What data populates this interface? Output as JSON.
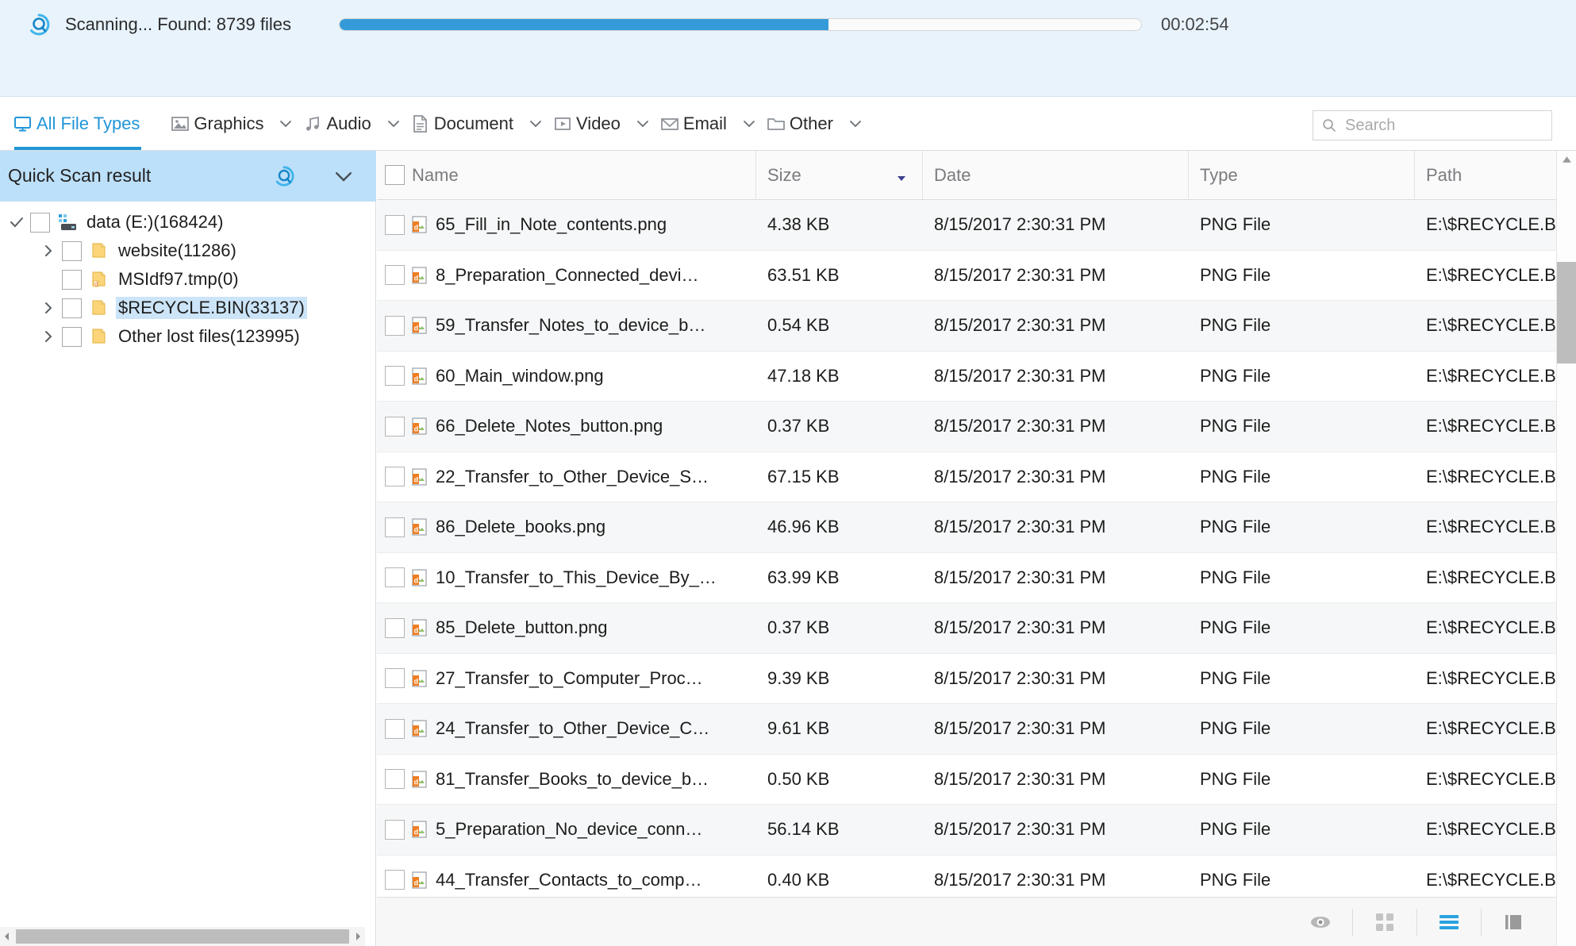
{
  "scan": {
    "status_text": "Scanning... Found: 8739 files",
    "progress_percent": 61,
    "elapsed_time": "00:02:54",
    "scan_icon": "scan-target-icon",
    "accent_color": "#349bd8",
    "bar_background": "#e8f3fc"
  },
  "filters": {
    "tabs": [
      {
        "label": "All File Types",
        "icon": "monitor-icon",
        "active": true,
        "has_caret": false
      },
      {
        "label": "Graphics",
        "icon": "image-icon",
        "active": false,
        "has_caret": true
      },
      {
        "label": "Audio",
        "icon": "music-note-icon",
        "active": false,
        "has_caret": true
      },
      {
        "label": "Document",
        "icon": "document-icon",
        "active": false,
        "has_caret": true
      },
      {
        "label": "Video",
        "icon": "play-frame-icon",
        "active": false,
        "has_caret": true
      },
      {
        "label": "Email",
        "icon": "envelope-icon",
        "active": false,
        "has_caret": true
      },
      {
        "label": "Other",
        "icon": "folder-outline-icon",
        "active": false,
        "has_caret": true
      }
    ],
    "active_color": "#2196d8"
  },
  "search": {
    "placeholder": "Search",
    "value": "",
    "icon": "search-icon"
  },
  "sidebar": {
    "title": "Quick Scan result",
    "header_icon": "scan-target-icon",
    "collapse_icon": "chevron-down-icon",
    "header_background": "#bde0fa",
    "selection_color": "#cce4f7",
    "tree": [
      {
        "label": "data (E:)(168424)",
        "level": 1,
        "icon": "drive-icon",
        "expander": "check-mark",
        "checked": false,
        "selected": false
      },
      {
        "label": "website(11286)",
        "level": 2,
        "icon": "folder-icon",
        "expander": "chevron-right",
        "checked": false,
        "selected": false
      },
      {
        "label": "MSIdf97.tmp(0)",
        "level": 2,
        "icon": "folder-doc-icon",
        "expander": "none",
        "checked": false,
        "selected": false
      },
      {
        "label": "$RECYCLE.BIN(33137)",
        "level": 2,
        "icon": "folder-icon",
        "expander": "chevron-right",
        "checked": false,
        "selected": true
      },
      {
        "label": "Other lost files(123995)",
        "level": 2,
        "icon": "folder-icon",
        "expander": "chevron-right",
        "checked": false,
        "selected": false
      }
    ]
  },
  "table": {
    "columns": [
      {
        "key": "name",
        "label": "Name",
        "has_checkbox": true,
        "sorted": false
      },
      {
        "key": "size",
        "label": "Size",
        "has_checkbox": false,
        "sorted": true,
        "sort_direction": "desc"
      },
      {
        "key": "date",
        "label": "Date",
        "has_checkbox": false,
        "sorted": false
      },
      {
        "key": "type",
        "label": "Type",
        "has_checkbox": false,
        "sorted": false
      },
      {
        "key": "path",
        "label": "Path",
        "has_checkbox": false,
        "sorted": false
      }
    ],
    "rows": [
      {
        "name": "65_Fill_in_Note_contents.png",
        "size": "4.38 KB",
        "date": "8/15/2017 2:30:31 PM",
        "type": "PNG File",
        "path": "E:\\$RECYCLE.BI...",
        "icon": "png-file-icon",
        "checked": false
      },
      {
        "name": "8_Preparation_Connected_devi…",
        "size": "63.51 KB",
        "date": "8/15/2017 2:30:31 PM",
        "type": "PNG File",
        "path": "E:\\$RECYCLE.BI...",
        "icon": "png-file-icon",
        "checked": false
      },
      {
        "name": "59_Transfer_Notes_to_device_b…",
        "size": "0.54 KB",
        "date": "8/15/2017 2:30:31 PM",
        "type": "PNG File",
        "path": "E:\\$RECYCLE.BI...",
        "icon": "png-file-icon",
        "checked": false
      },
      {
        "name": "60_Main_window.png",
        "size": "47.18 KB",
        "date": "8/15/2017 2:30:31 PM",
        "type": "PNG File",
        "path": "E:\\$RECYCLE.BI...",
        "icon": "png-file-icon",
        "checked": false
      },
      {
        "name": "66_Delete_Notes_button.png",
        "size": "0.37 KB",
        "date": "8/15/2017 2:30:31 PM",
        "type": "PNG File",
        "path": "E:\\$RECYCLE.BI...",
        "icon": "png-file-icon",
        "checked": false
      },
      {
        "name": "22_Transfer_to_Other_Device_S…",
        "size": "67.15 KB",
        "date": "8/15/2017 2:30:31 PM",
        "type": "PNG File",
        "path": "E:\\$RECYCLE.BI...",
        "icon": "png-file-icon",
        "checked": false
      },
      {
        "name": "86_Delete_books.png",
        "size": "46.96 KB",
        "date": "8/15/2017 2:30:31 PM",
        "type": "PNG File",
        "path": "E:\\$RECYCLE.BI...",
        "icon": "png-file-icon",
        "checked": false
      },
      {
        "name": "10_Transfer_to_This_Device_By_…",
        "size": "63.99 KB",
        "date": "8/15/2017 2:30:31 PM",
        "type": "PNG File",
        "path": "E:\\$RECYCLE.BI...",
        "icon": "png-file-icon",
        "checked": false
      },
      {
        "name": "85_Delete_button.png",
        "size": "0.37 KB",
        "date": "8/15/2017 2:30:31 PM",
        "type": "PNG File",
        "path": "E:\\$RECYCLE.BI...",
        "icon": "png-file-icon",
        "checked": false
      },
      {
        "name": "27_Transfer_to_Computer_Proc…",
        "size": "9.39 KB",
        "date": "8/15/2017 2:30:31 PM",
        "type": "PNG File",
        "path": "E:\\$RECYCLE.BI...",
        "icon": "png-file-icon",
        "checked": false
      },
      {
        "name": "24_Transfer_to_Other_Device_C…",
        "size": "9.61 KB",
        "date": "8/15/2017 2:30:31 PM",
        "type": "PNG File",
        "path": "E:\\$RECYCLE.BI...",
        "icon": "png-file-icon",
        "checked": false
      },
      {
        "name": "81_Transfer_Books_to_device_b…",
        "size": "0.50 KB",
        "date": "8/15/2017 2:30:31 PM",
        "type": "PNG File",
        "path": "E:\\$RECYCLE.BI...",
        "icon": "png-file-icon",
        "checked": false
      },
      {
        "name": "5_Preparation_No_device_conn…",
        "size": "56.14 KB",
        "date": "8/15/2017 2:30:31 PM",
        "type": "PNG File",
        "path": "E:\\$RECYCLE.BI...",
        "icon": "png-file-icon",
        "checked": false
      },
      {
        "name": "44_Transfer_Contacts_to_comp…",
        "size": "0.40 KB",
        "date": "8/15/2017 2:30:31 PM",
        "type": "PNG File",
        "path": "E:\\$RECYCLE.BI...",
        "icon": "png-file-icon",
        "checked": false
      }
    ]
  },
  "status_bar": {
    "buttons": [
      {
        "name": "preview-eye-icon",
        "active": false
      },
      {
        "name": "grid-view-icon",
        "active": false
      },
      {
        "name": "list-view-icon",
        "active": true
      },
      {
        "name": "detail-pane-icon",
        "active": false
      }
    ],
    "active_color": "#29a3e0"
  }
}
